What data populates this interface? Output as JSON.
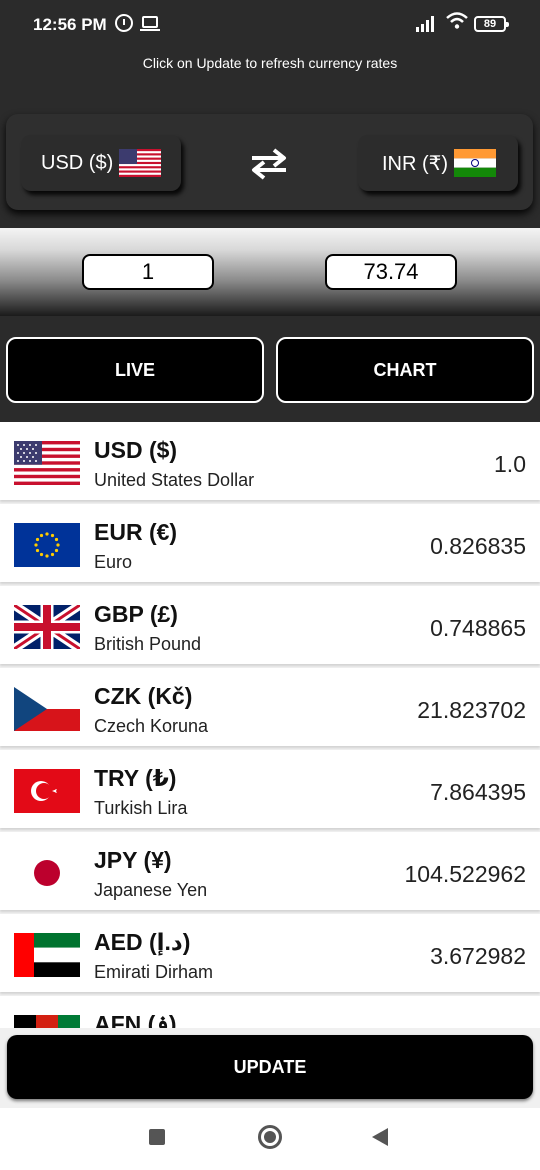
{
  "status": {
    "time": "12:56 PM",
    "battery": "89"
  },
  "hint": "Click on Update to refresh currency rates",
  "selector": {
    "from_label": "USD ($)",
    "to_label": "INR (₹)"
  },
  "amounts": {
    "from_value": "1",
    "to_value": "73.74"
  },
  "tabs": {
    "live": "LIVE",
    "chart": "CHART"
  },
  "currencies": [
    {
      "code": "USD ($)",
      "name": "United States Dollar",
      "rate": "1.0",
      "flag": "us-flag"
    },
    {
      "code": "EUR (€)",
      "name": "Euro",
      "rate": "0.826835",
      "flag": "eu-flag"
    },
    {
      "code": "GBP (£)",
      "name": "British Pound",
      "rate": "0.748865",
      "flag": "uk-flag"
    },
    {
      "code": "CZK (Kč)",
      "name": "Czech Koruna",
      "rate": "21.823702",
      "flag": "cz-flag"
    },
    {
      "code": "TRY (₺)",
      "name": "Turkish Lira",
      "rate": "7.864395",
      "flag": "tr-flag"
    },
    {
      "code": "JPY (¥)",
      "name": "Japanese Yen",
      "rate": "104.522962",
      "flag": "jp-flag"
    },
    {
      "code": "AED (د.إ)",
      "name": "Emirati Dirham",
      "rate": "3.672982",
      "flag": "ae-flag"
    },
    {
      "code": "AFN (؋)",
      "name": "",
      "rate": "",
      "flag": "af-flag"
    }
  ],
  "update_label": "UPDATE",
  "colors": {
    "background": "#2b2b2b",
    "button": "#000000",
    "list_bg": "#f0f0f0"
  }
}
